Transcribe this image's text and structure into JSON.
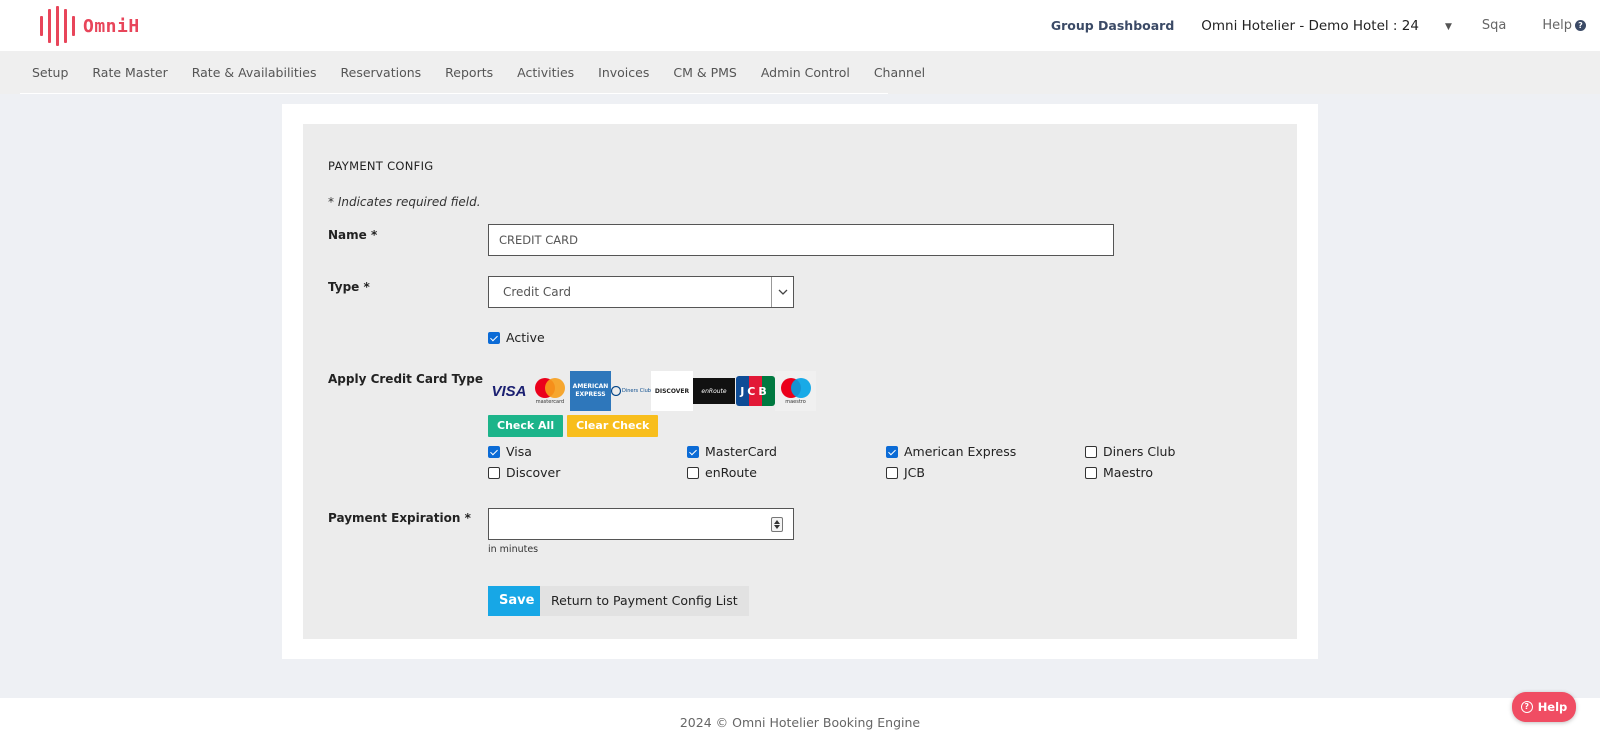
{
  "header": {
    "logo_text": "OmniH",
    "group_dashboard": "Group Dashboard",
    "hotel_name": "Omni Hotelier - Demo Hotel : 24",
    "user": "Sqa",
    "help": "Help"
  },
  "nav": {
    "items": [
      "Setup",
      "Rate Master",
      "Rate & Availabilities",
      "Reservations",
      "Reports",
      "Activities",
      "Invoices",
      "CM & PMS",
      "Admin Control",
      "Channel"
    ]
  },
  "form": {
    "title": "PAYMENT CONFIG",
    "required_note": "* Indicates required field.",
    "name_label": "Name *",
    "name_value": "CREDIT CARD",
    "type_label": "Type *",
    "type_value": "Credit Card",
    "active_label": "Active",
    "active_checked": true,
    "card_type_label": "Apply Credit Card Type",
    "check_all": "Check All",
    "clear_check": "Clear Check",
    "card_options": [
      {
        "label": "Visa",
        "checked": true
      },
      {
        "label": "MasterCard",
        "checked": true
      },
      {
        "label": "American Express",
        "checked": true
      },
      {
        "label": "Diners Club",
        "checked": false
      },
      {
        "label": "Discover",
        "checked": false
      },
      {
        "label": "enRoute",
        "checked": false
      },
      {
        "label": "JCB",
        "checked": false
      },
      {
        "label": "Maestro",
        "checked": false
      }
    ],
    "card_logos": {
      "visa": "VISA",
      "mastercard": "mastercard",
      "amex_line1": "AMERICAN",
      "amex_line2": "EXPRESS",
      "diners": "Diners Club",
      "discover": "DISCOVER",
      "enroute": "enRoute",
      "jcb": "JCB",
      "maestro": "maestro"
    },
    "expiration_label": "Payment Expiration *",
    "expiration_value": "",
    "expiration_hint": "in minutes",
    "save": "Save",
    "return": "Return to Payment Config List"
  },
  "footer": {
    "text": "2024 © Omni Hotelier Booking Engine",
    "help_button": "Help"
  },
  "colors": {
    "brand": "#e8455a",
    "primary": "#17a7e6",
    "check_all": "#1cb48a",
    "clear_check": "#f8be1d",
    "checkbox": "#0b6bd6"
  }
}
